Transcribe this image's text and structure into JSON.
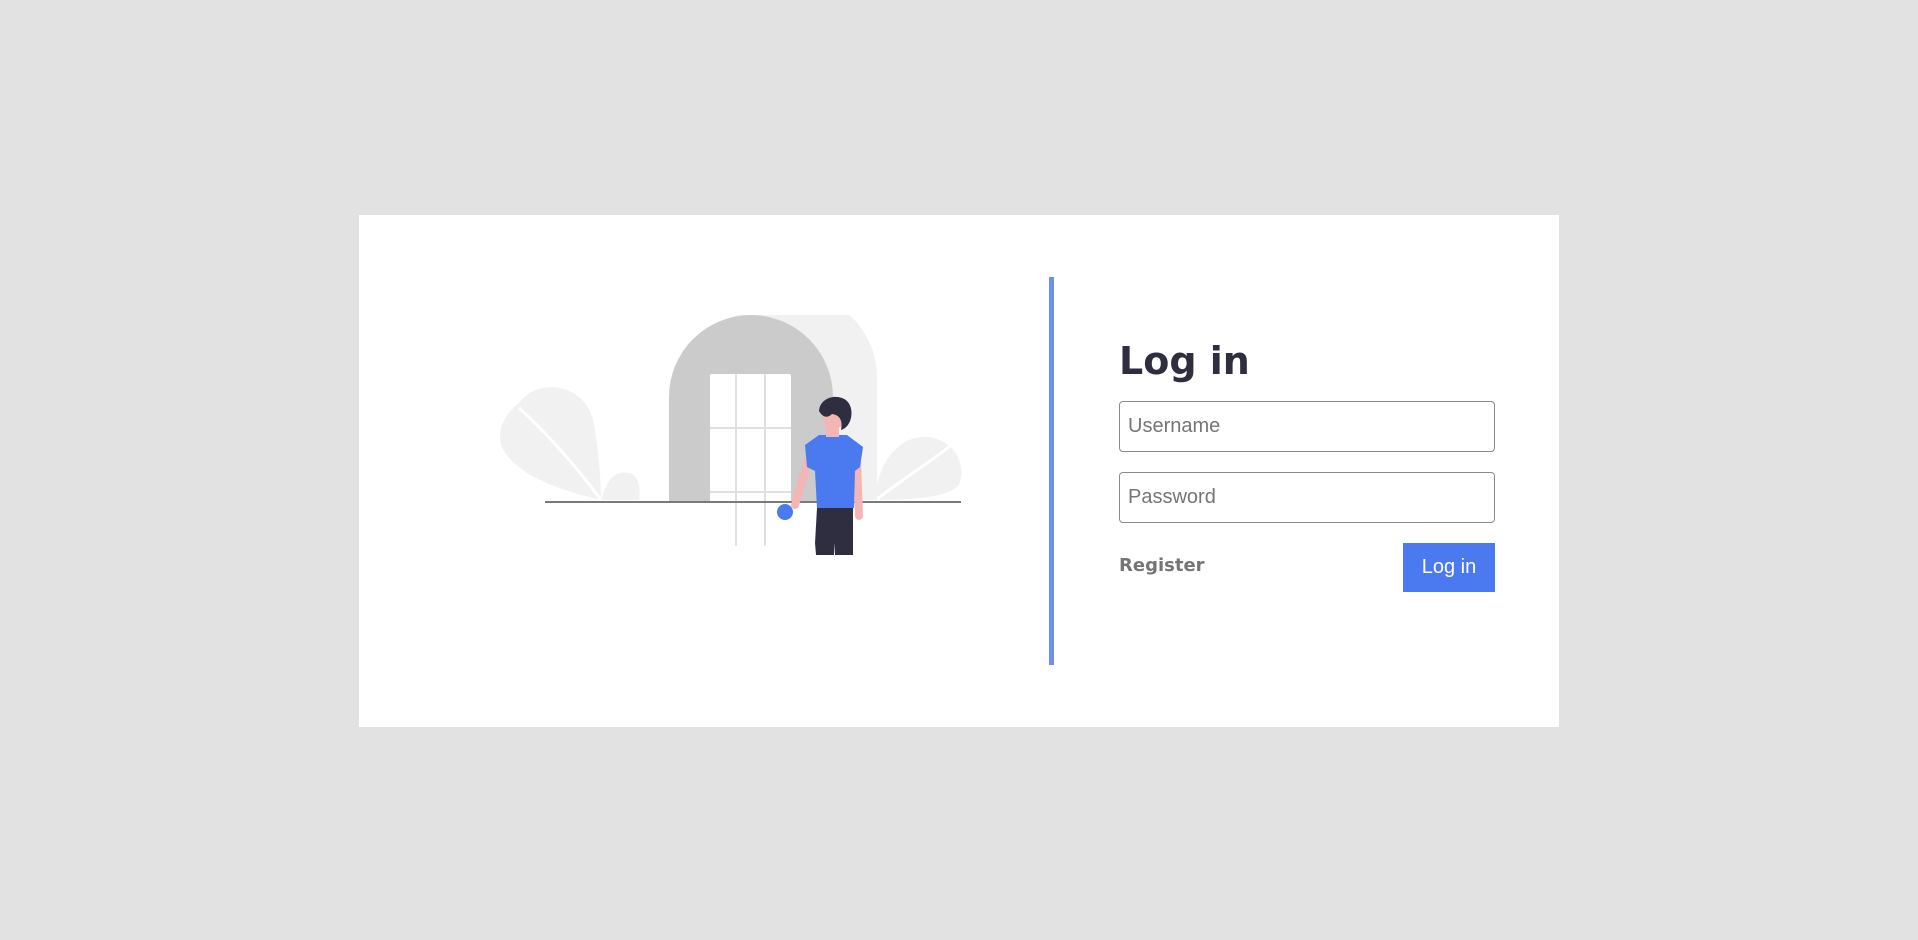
{
  "login": {
    "title": "Log in",
    "username": {
      "placeholder": "Username",
      "value": ""
    },
    "password": {
      "placeholder": "Password",
      "value": ""
    },
    "register_label": "Register",
    "submit_label": "Log in"
  },
  "colors": {
    "page_background": "#e3e2e3",
    "card_background": "#ffffff",
    "accent": "#4a79f0",
    "divider": "#6c8ff0",
    "title_text": "#2f2e41",
    "muted_text": "#757575"
  },
  "illustration": {
    "icon": "person-opening-door-illustration"
  }
}
